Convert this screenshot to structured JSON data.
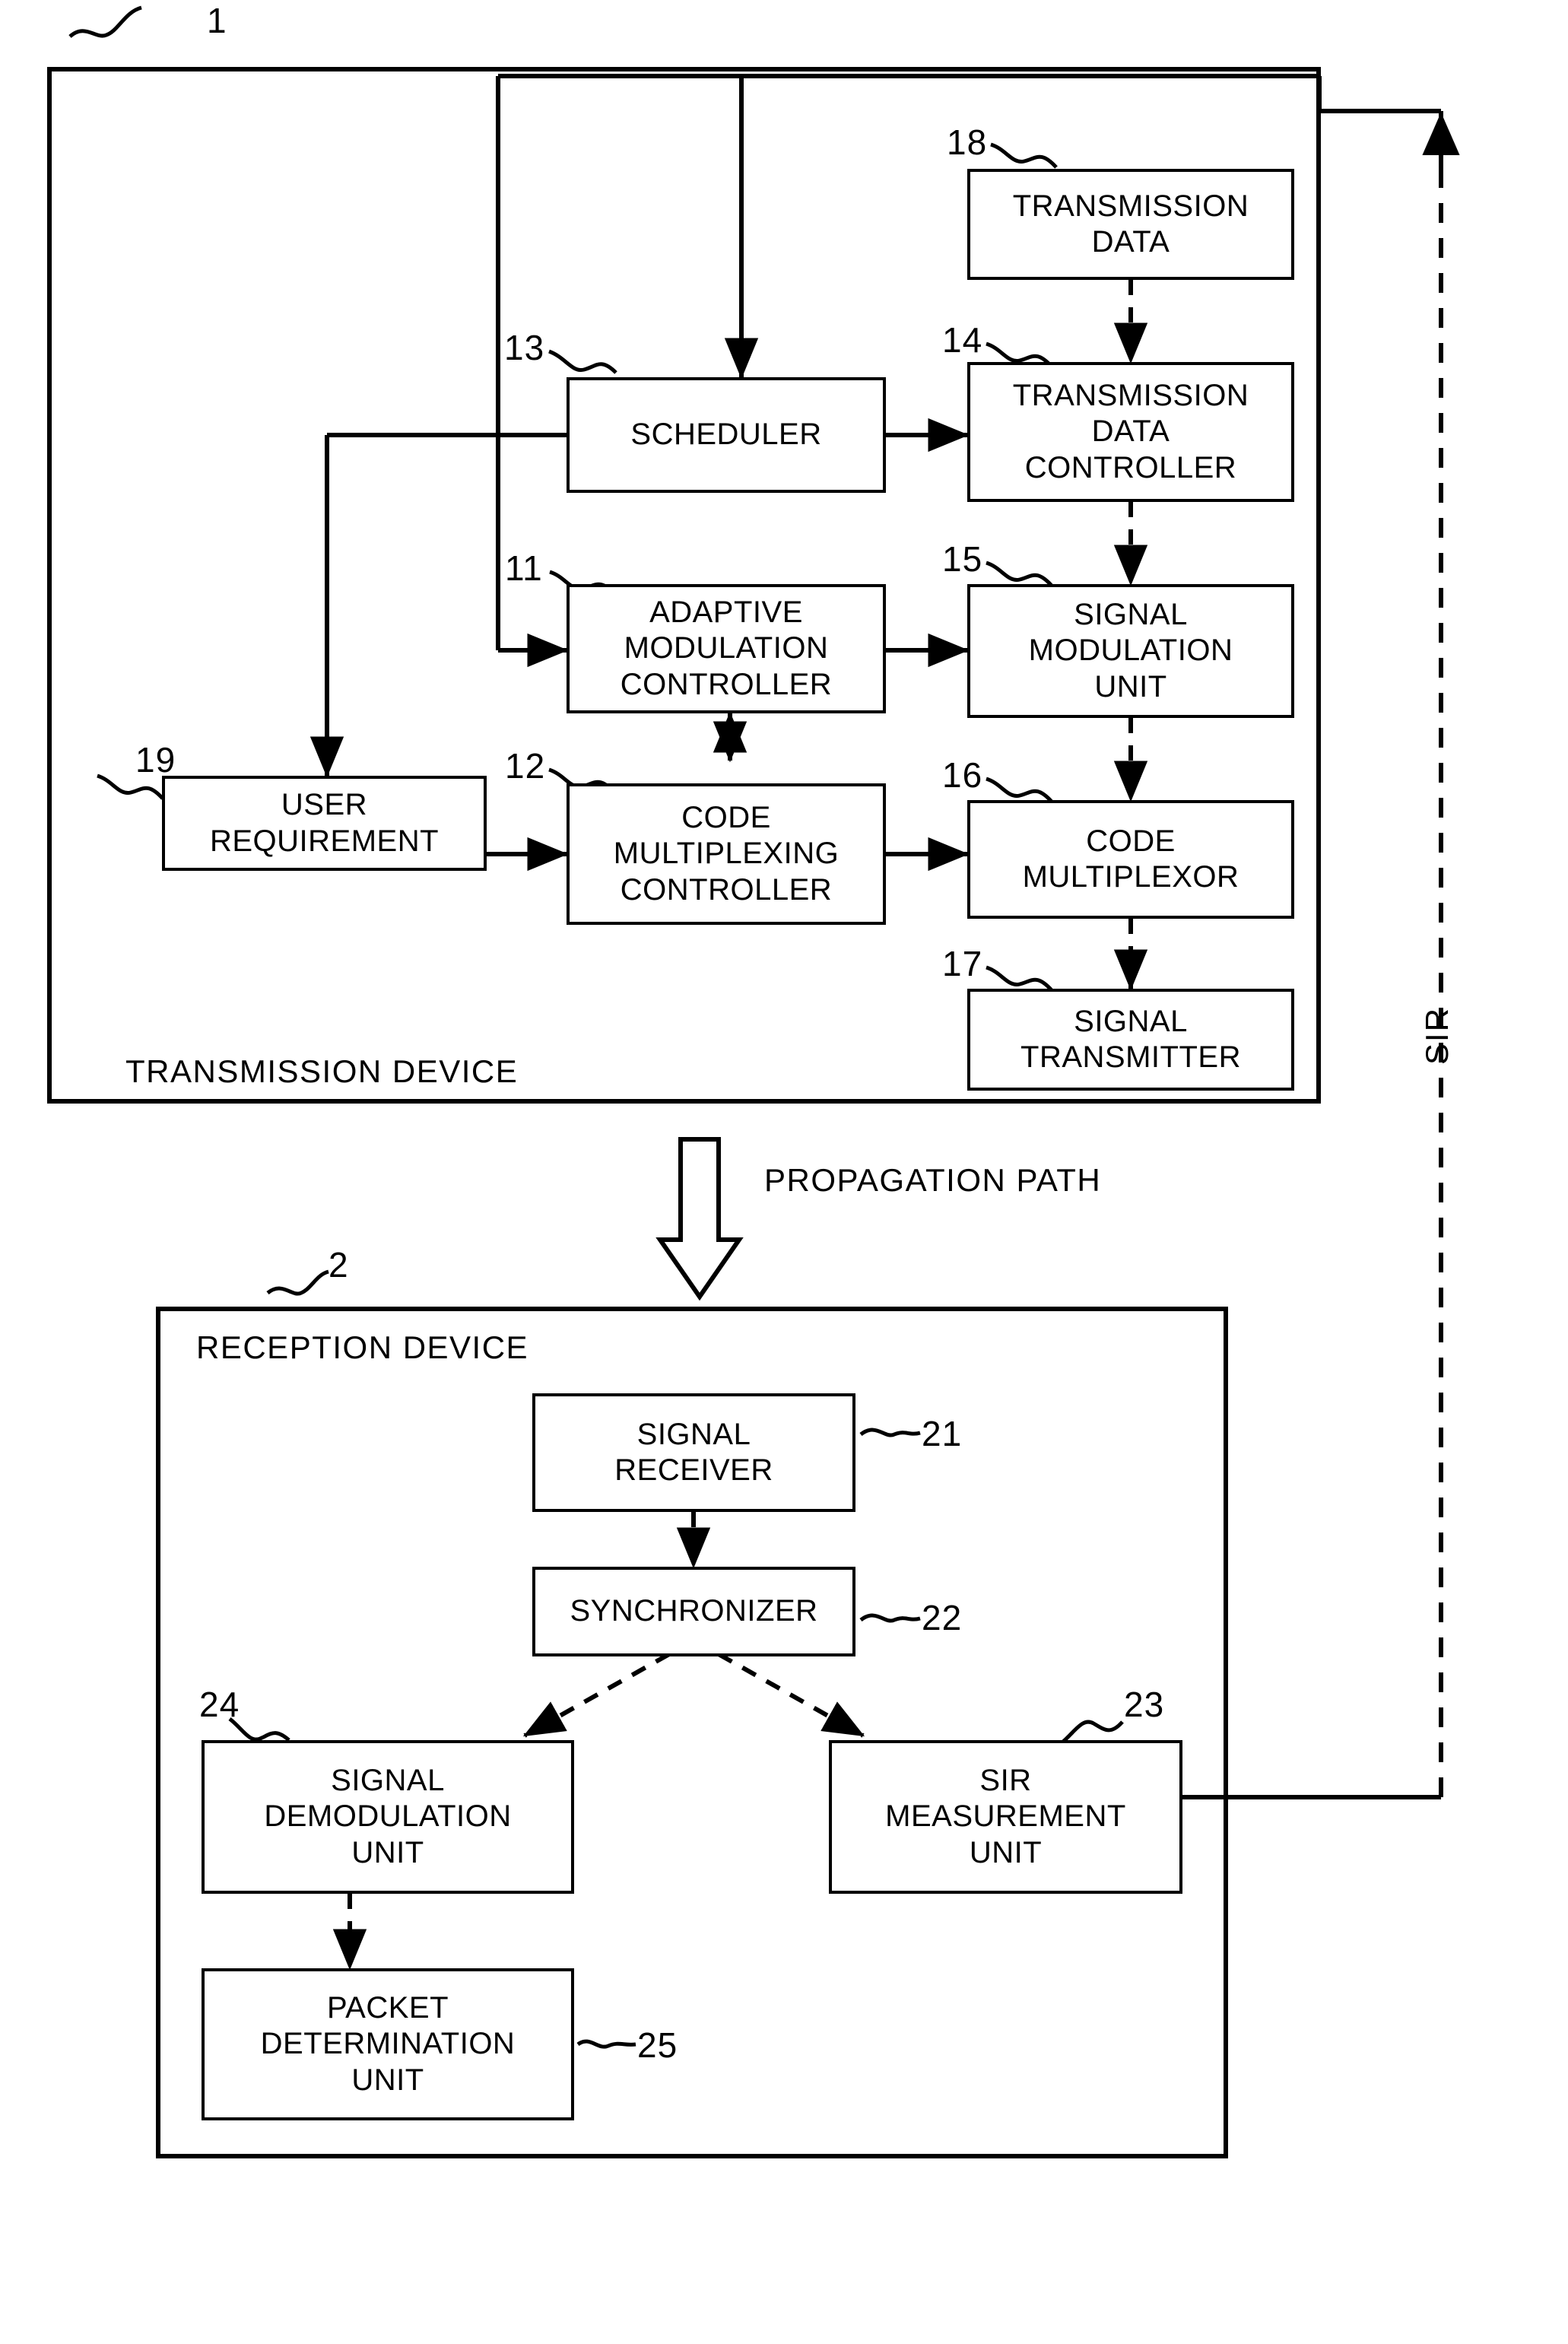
{
  "figure": {
    "type": "patent-block-diagram",
    "transmission_device": {
      "ref": "1",
      "label": "TRANSMISSION DEVICE",
      "blocks": [
        {
          "ref": "18",
          "label": "TRANSMISSION\nDATA"
        },
        {
          "ref": "13",
          "label": "SCHEDULER"
        },
        {
          "ref": "14",
          "label": "TRANSMISSION\nDATA\nCONTROLLER"
        },
        {
          "ref": "11",
          "label": "ADAPTIVE\nMODULATION\nCONTROLLER"
        },
        {
          "ref": "15",
          "label": "SIGNAL\nMODULATION\nUNIT"
        },
        {
          "ref": "19",
          "label": "USER\nREQUIREMENT"
        },
        {
          "ref": "12",
          "label": "CODE\nMULTIPLEXING\nCONTROLLER"
        },
        {
          "ref": "16",
          "label": "CODE\nMULTIPLEXOR"
        },
        {
          "ref": "17",
          "label": "SIGNAL\nTRANSMITTER"
        }
      ]
    },
    "propagation": {
      "label": "PROPAGATION PATH"
    },
    "feedback": {
      "label": "SIR"
    },
    "reception_device": {
      "ref": "2",
      "label": "RECEPTION DEVICE",
      "blocks": [
        {
          "ref": "21",
          "label": "SIGNAL\nRECEIVER"
        },
        {
          "ref": "22",
          "label": "SYNCHRONIZER"
        },
        {
          "ref": "24",
          "label": "SIGNAL\nDEMODULATION\nUNIT"
        },
        {
          "ref": "23",
          "label": "SIR\nMEASUREMENT\nUNIT"
        },
        {
          "ref": "25",
          "label": "PACKET\nDETERMINATION\nUNIT"
        }
      ]
    },
    "colors": {
      "ink": "#000000",
      "paper": "#ffffff"
    }
  }
}
